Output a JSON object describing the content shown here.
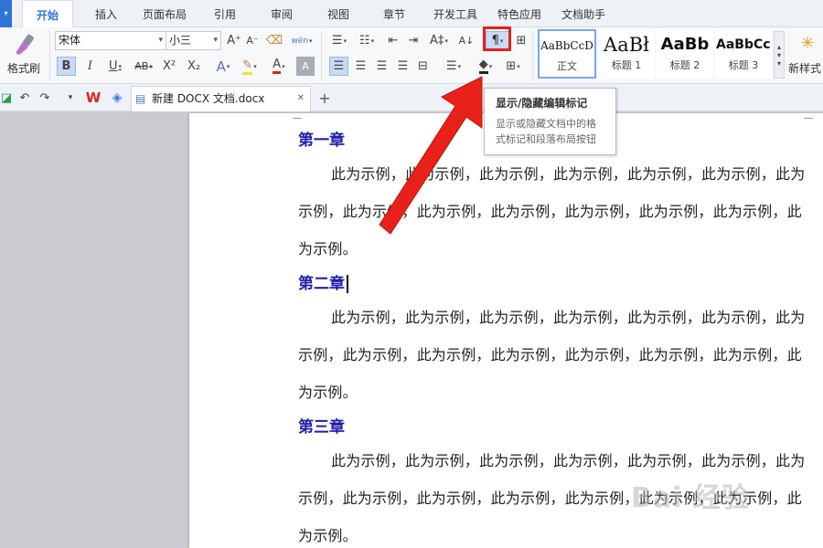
{
  "tabs": {
    "active": "开始",
    "items": [
      "插入",
      "页面布局",
      "引用",
      "审阅",
      "视图",
      "章节",
      "开发工具",
      "特色应用",
      "文档助手"
    ]
  },
  "ribbon": {
    "format_painter_label": "格式刷",
    "font_name": "宋体",
    "font_size": "小三",
    "font_grow": "A⁺",
    "font_shrink": "A⁻",
    "phonetic": "wén",
    "bold": "B",
    "italic": "I",
    "underline": "U",
    "strike": "AB",
    "superscript": "X²",
    "subscript": "X₂",
    "text_effect": "A",
    "font_color": "A",
    "char_shade": "A",
    "style_samples": {
      "s0": "AaBbCcD",
      "s1": "AaBł",
      "s2": "AaBb",
      "s3": "AaBbCcl"
    },
    "style_names": {
      "s0": "正文",
      "s1": "标题 1",
      "s2": "标题 2",
      "s3": "标题 3"
    },
    "new_style_label": "新样式",
    "accent_color": "#2f73d9"
  },
  "tooltip": {
    "title": "显示/隐藏编辑标记",
    "description": "显示或隐藏文档中的格式标记和段落布局按钮"
  },
  "doc_tab": {
    "filename": "新建 DOCX 文档.docx"
  },
  "document": {
    "h1": "第一章",
    "p1": "此为示例，此为示例，此为示例，此为示例，此为示例，此为示例，此为示例，此为示例，此为示例，此为示例，此为示例，此为示例，此为示例，此为示例。",
    "h2": "第二章",
    "p2": "此为示例，此为示例，此为示例，此为示例，此为示例，此为示例，此为示例，此为示例，此为示例，此为示例，此为示例，此为示例，此为示例，此为示例。",
    "h3": "第三章",
    "p3": "此为示例，此为示例，此为示例，此为示例，此为示例，此为示例，此为示例，此为示例，此为示例，此为示例，此为示例，此为示例，此为示例，此为示例。"
  },
  "watermark": "Bai 经验"
}
